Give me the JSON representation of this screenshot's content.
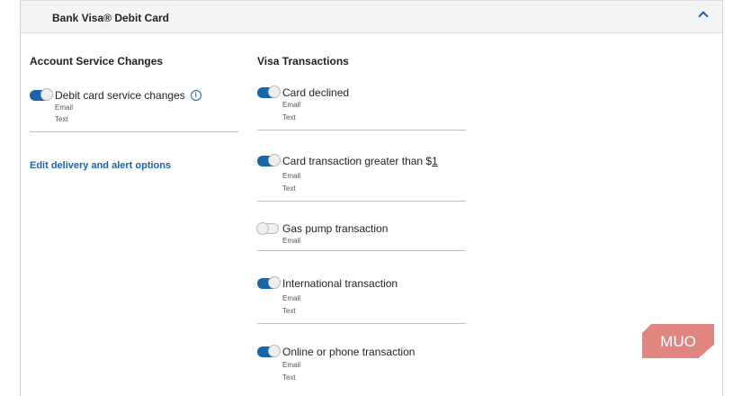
{
  "card_title": "Bank Visa® Debit Card",
  "left": {
    "heading": "Account Service Changes",
    "items": [
      {
        "label": "Debit card service changes",
        "on": true,
        "channels": [
          "Email",
          "Text"
        ]
      }
    ],
    "link": "Edit delivery and alert options"
  },
  "right": {
    "heading": "Visa Transactions",
    "items": [
      {
        "label": "Card declined",
        "on": true,
        "channels": [
          "Email",
          "Text"
        ]
      },
      {
        "label": "Card transaction greater than $",
        "amount": "1",
        "on": true,
        "channels": [
          "Email",
          "Text"
        ]
      },
      {
        "label": "Gas pump transaction",
        "on": false,
        "channels": [
          "Email"
        ]
      },
      {
        "label": "International transaction",
        "on": true,
        "channels": [
          "Email",
          "Text"
        ]
      },
      {
        "label": "Online or phone transaction",
        "on": true,
        "channels": [
          "Email",
          "Text"
        ]
      }
    ]
  },
  "watermark": "MUO"
}
